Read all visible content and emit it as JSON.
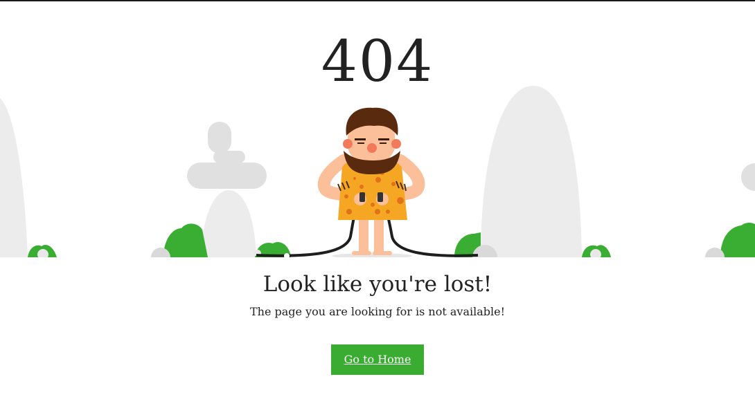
{
  "error": {
    "code": "404"
  },
  "message": {
    "headline": "Look like you're lost!",
    "subtext": "The page you are looking for is not available!"
  },
  "actions": {
    "home_label": "Go to Home"
  },
  "colors": {
    "accent": "#39ac31",
    "rock": "#e0e0e0",
    "bush": "#3aad33",
    "text": "#222222"
  },
  "illustration": {
    "subject": "caveman-holding-unplugged-cable"
  }
}
